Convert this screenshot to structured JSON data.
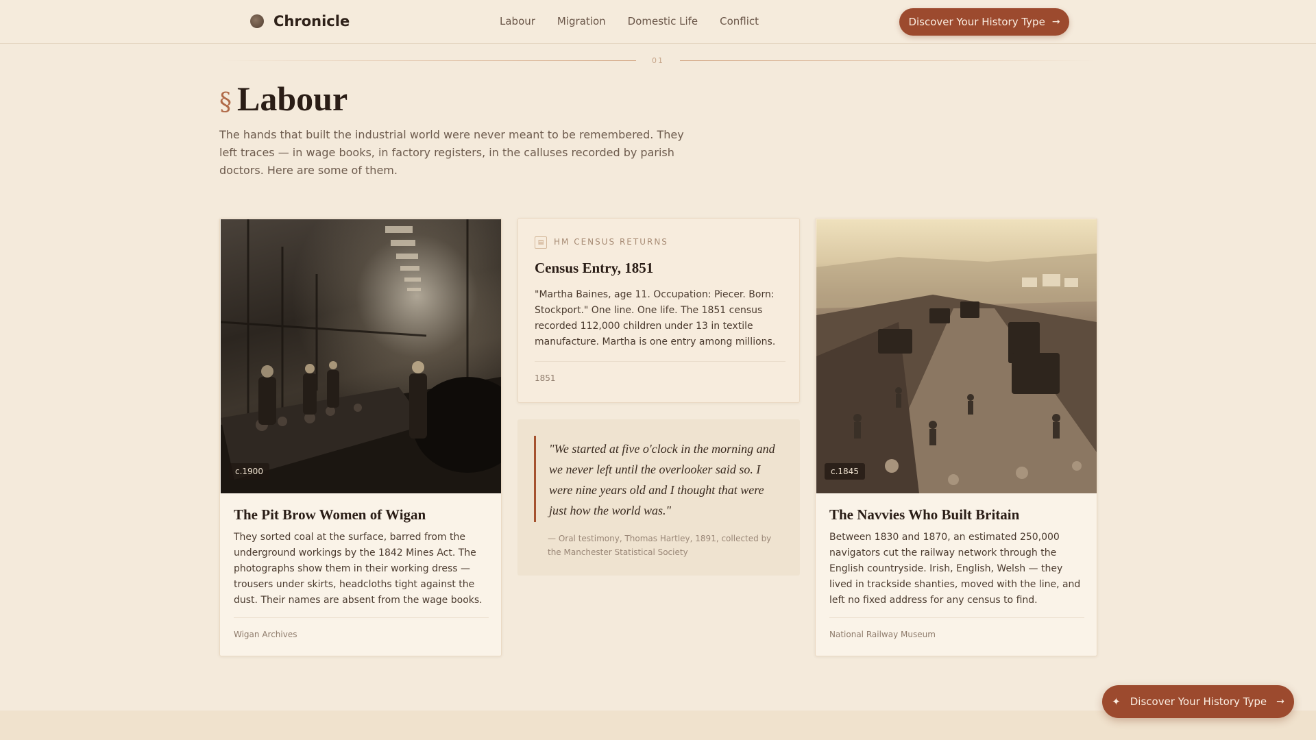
{
  "brand": {
    "name": "Chronicle",
    "logo_icon": "globe-icon"
  },
  "nav": {
    "items": [
      {
        "label": "Labour"
      },
      {
        "label": "Migration"
      },
      {
        "label": "Domestic Life"
      },
      {
        "label": "Conflict"
      }
    ]
  },
  "header_cta": {
    "label": "Discover Your History Type",
    "icon": "arrow-right-icon"
  },
  "section": {
    "number": "01",
    "mark": "§",
    "title": "Labour",
    "intro": "The hands that built the industrial world were never meant to be remembered. They left traces — in wage books, in factory registers, in the calluses recorded by parish doctors. Here are some of them."
  },
  "cards": {
    "pit_brow": {
      "date": "c.1900",
      "title": "The Pit Brow Women of Wigan",
      "body": "They sorted coal at the surface, barred from the underground workings by the 1842 Mines Act. The photographs show them in their working dress — trousers under skirts, headcloths tight against the dust. Their names are absent from the wage books.",
      "source": "Wigan Archives"
    },
    "census": {
      "label": "HM CENSUS RETURNS",
      "icon": "document-icon",
      "title": "Census Entry, 1851",
      "body": "\"Martha Baines, age 11. Occupation: Piecer. Born: Stockport.\" One line. One life. The 1851 census recorded 112,000 children under 13 in textile manufacture. Martha is one entry among millions.",
      "date": "1851"
    },
    "quote": {
      "text": "\"We started at five o'clock in the morning and we never left until the overlooker said so. I were nine years old and I thought that were just how the world was.\"",
      "attribution": "— Oral testimony, Thomas Hartley, 1891, collected by the Manchester Statistical Society"
    },
    "navvies": {
      "date": "c.1845",
      "title": "The Navvies Who Built Britain",
      "body": "Between 1830 and 1870, an estimated 250,000 navigators cut the railway network through the English countryside. Irish, English, Welsh — they lived in trackside shanties, moved with the line, and left no fixed address for any census to find.",
      "source": "National Railway Museum"
    }
  },
  "float_cta": {
    "label": "Discover Your History Type",
    "icon": "sparkle-icon",
    "arrow_icon": "arrow-right-icon"
  },
  "colors": {
    "accent": "#9c4a2e",
    "background": "#f4eadb",
    "section_mark": "#b06a48"
  }
}
